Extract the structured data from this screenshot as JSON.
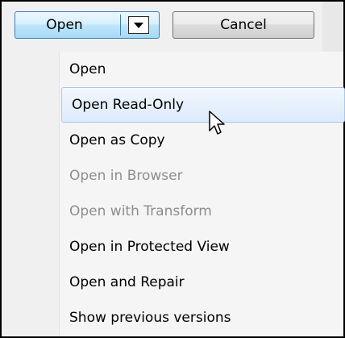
{
  "toolbar": {
    "open_label": "Open",
    "cancel_label": "Cancel",
    "dropdown_icon": "chevron-down-icon"
  },
  "menu": {
    "items": [
      {
        "label": "Open",
        "enabled": true,
        "hovered": false
      },
      {
        "label": "Open Read-Only",
        "enabled": true,
        "hovered": true
      },
      {
        "label": "Open as Copy",
        "enabled": true,
        "hovered": false
      },
      {
        "label": "Open in Browser",
        "enabled": false,
        "hovered": false
      },
      {
        "label": "Open with Transform",
        "enabled": false,
        "hovered": false
      },
      {
        "label": "Open in Protected View",
        "enabled": true,
        "hovered": false
      },
      {
        "label": "Open and Repair",
        "enabled": true,
        "hovered": false
      },
      {
        "label": "Show previous versions",
        "enabled": true,
        "hovered": false
      }
    ]
  },
  "colors": {
    "accent_border": "#3c7fb1",
    "hover_border": "#a8c8eb",
    "disabled_text": "#8d8d8d"
  }
}
